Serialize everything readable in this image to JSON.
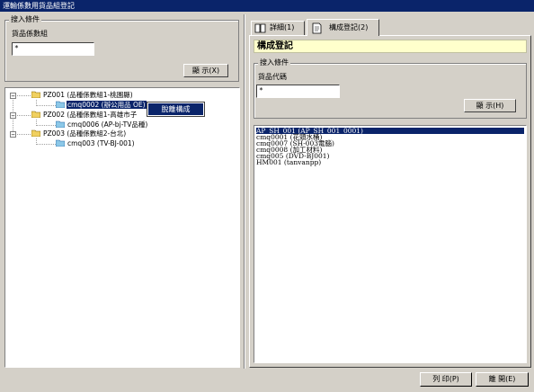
{
  "window": {
    "title": "運輸係數用貨品組登記"
  },
  "left": {
    "group_label": "搜入條件",
    "field_label": "貨品係數組",
    "field_value": "*",
    "show_button": "顯 示(X)",
    "tree": [
      {
        "label": "PZ001  (品種係數組1-桃園縣)",
        "children": [
          {
            "label": "cmq0002 (辦公用品 OE)",
            "selected": true
          }
        ]
      },
      {
        "label": "PZ002  (品種係數組1-高雄市子",
        "children": [
          {
            "label": "cmq0006  (AP-bj-TV品種)"
          }
        ]
      },
      {
        "label": "PZ003  (品種係數組2-台北)",
        "children": [
          {
            "label": "cmq003  (TV-BJ-001)"
          }
        ]
      }
    ],
    "context_menu": {
      "item": "脫離構成"
    }
  },
  "right": {
    "tabs": [
      {
        "label": "詳細(1)"
      },
      {
        "label": "構成登記(2)"
      }
    ],
    "section_title": "構成登記",
    "group_label": "搜入條件",
    "field_label": "貨品代碼",
    "field_value": "*",
    "show_button": "顯 示(H)",
    "list": [
      {
        "text": "AP_SH_001  (AP_SH_001_0001)",
        "selected": true
      },
      {
        "text": "cmq0001  (花頭水桶)"
      },
      {
        "text": "cmq0007  (SH-003電腦)"
      },
      {
        "text": "cmq0008  (加工材料)"
      },
      {
        "text": "cmq005  (DVD-BJ001)"
      },
      {
        "text": "HM001  (tanvanpp)"
      }
    ]
  },
  "footer": {
    "print_button": "列 印(P)",
    "close_button": "離 開(E)"
  },
  "colors": {
    "title_bg": "#0a246a",
    "face": "#d4d0c8",
    "section_header_bg": "#ffffcc",
    "selection": "#0a246a"
  },
  "icons": {
    "folder": "folder-icon",
    "tab1": "book-icon",
    "tab2": "document-icon"
  }
}
